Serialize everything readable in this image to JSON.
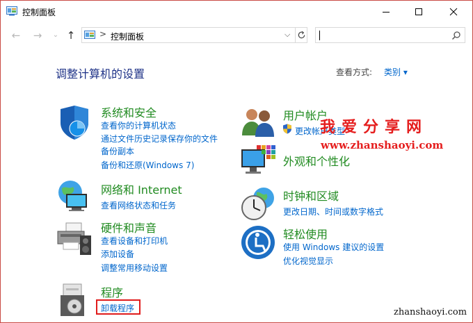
{
  "window": {
    "title": "控制面板",
    "controls": {
      "minimize": "minimize-icon",
      "maximize": "maximize-icon",
      "close": "close-icon"
    }
  },
  "nav": {
    "address_path": "控制面板",
    "address_separator": ">",
    "search_placeholder": ""
  },
  "header": {
    "title": "调整计算机的设置",
    "view_by_label": "查看方式:",
    "view_by_value": "类别 ▾"
  },
  "categories_left": [
    {
      "title": "系统和安全",
      "icon": "shield-icon",
      "links": [
        "查看你的计算机状态",
        "通过文件历史记录保存你的文件",
        "备份副本",
        "备份和还原(Windows 7)"
      ]
    },
    {
      "title": "网络和 Internet",
      "icon": "network-globe-icon",
      "links": [
        "查看网络状态和任务"
      ]
    },
    {
      "title": "硬件和声音",
      "icon": "printer-speaker-icon",
      "links": [
        "查看设备和打印机",
        "添加设备",
        "调整常用移动设置"
      ]
    },
    {
      "title": "程序",
      "icon": "programs-disc-icon",
      "links": [
        "卸载程序"
      ]
    }
  ],
  "categories_right": [
    {
      "title": "用户帐户",
      "icon": "users-icon",
      "links": [
        "更改帐户类型"
      ]
    },
    {
      "title": "外观和个性化",
      "icon": "monitor-palette-icon",
      "links": []
    },
    {
      "title": "时钟和区域",
      "icon": "clock-globe-icon",
      "links": [
        "更改日期、时间或数字格式"
      ]
    },
    {
      "title": "轻松使用",
      "icon": "ease-of-access-icon",
      "links": [
        "使用 Windows 建议的设置",
        "优化视觉显示"
      ]
    }
  ],
  "watermark": {
    "title": "我爱分享网",
    "url": "www.zhanshaoyi.com",
    "bottom": "zhanshaoyi.com"
  },
  "colors": {
    "link": "#0066cc",
    "category_title": "#218b21",
    "page_title": "#1e3287",
    "highlight": "#e01b1b",
    "watermark": "#e51e1e"
  }
}
